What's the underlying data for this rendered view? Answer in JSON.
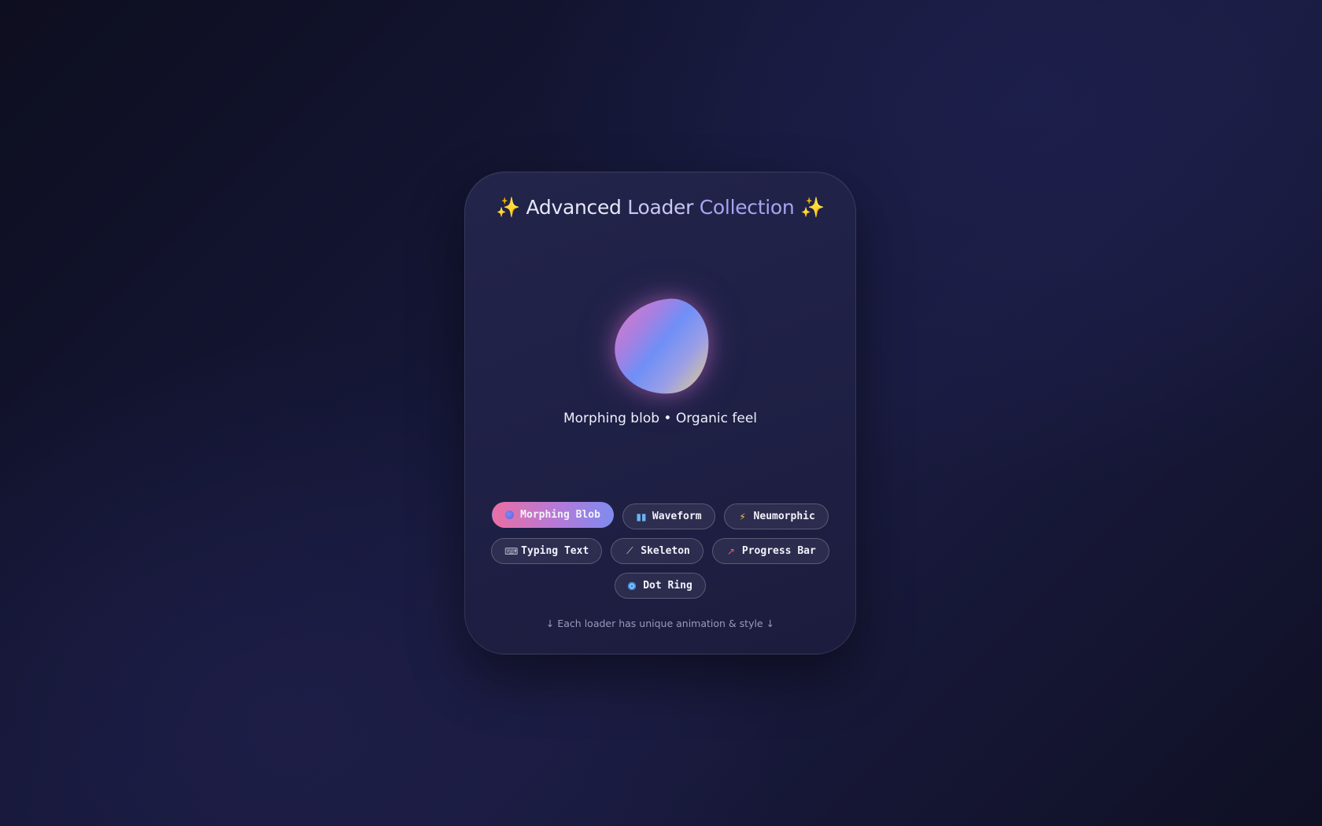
{
  "title": {
    "sparkle_left": "✨",
    "part1": "Advanced",
    "part2": "Loader",
    "part3": "Collection",
    "sparkle_right": "✨"
  },
  "loader": {
    "name": "Morphing Blob",
    "caption": "Morphing blob • Organic feel",
    "gradient_colors": [
      "#e07ac4",
      "#6f8ff7",
      "#e8d08a"
    ]
  },
  "buttons": [
    {
      "label": "Morphing Blob",
      "icon": "blob-dot-icon",
      "active": true
    },
    {
      "label": "Waveform",
      "icon": "bar-chart-icon",
      "active": false
    },
    {
      "label": "Neumorphic",
      "icon": "lightning-icon",
      "active": false
    },
    {
      "label": "Typing Text",
      "icon": "keyboard-icon",
      "active": false
    },
    {
      "label": "Skeleton",
      "icon": "bone-icon",
      "active": false
    },
    {
      "label": "Progress Bar",
      "icon": "chart-up-icon",
      "active": false
    },
    {
      "label": "Dot Ring",
      "icon": "ring-dot-icon",
      "active": false
    }
  ],
  "footer": "↓ Each loader has unique animation & style ↓",
  "colors": {
    "accent_pink": "#ea6fa4",
    "accent_blue": "#7f8bef",
    "sparkle": "#f6c445",
    "background": "#16183a"
  }
}
